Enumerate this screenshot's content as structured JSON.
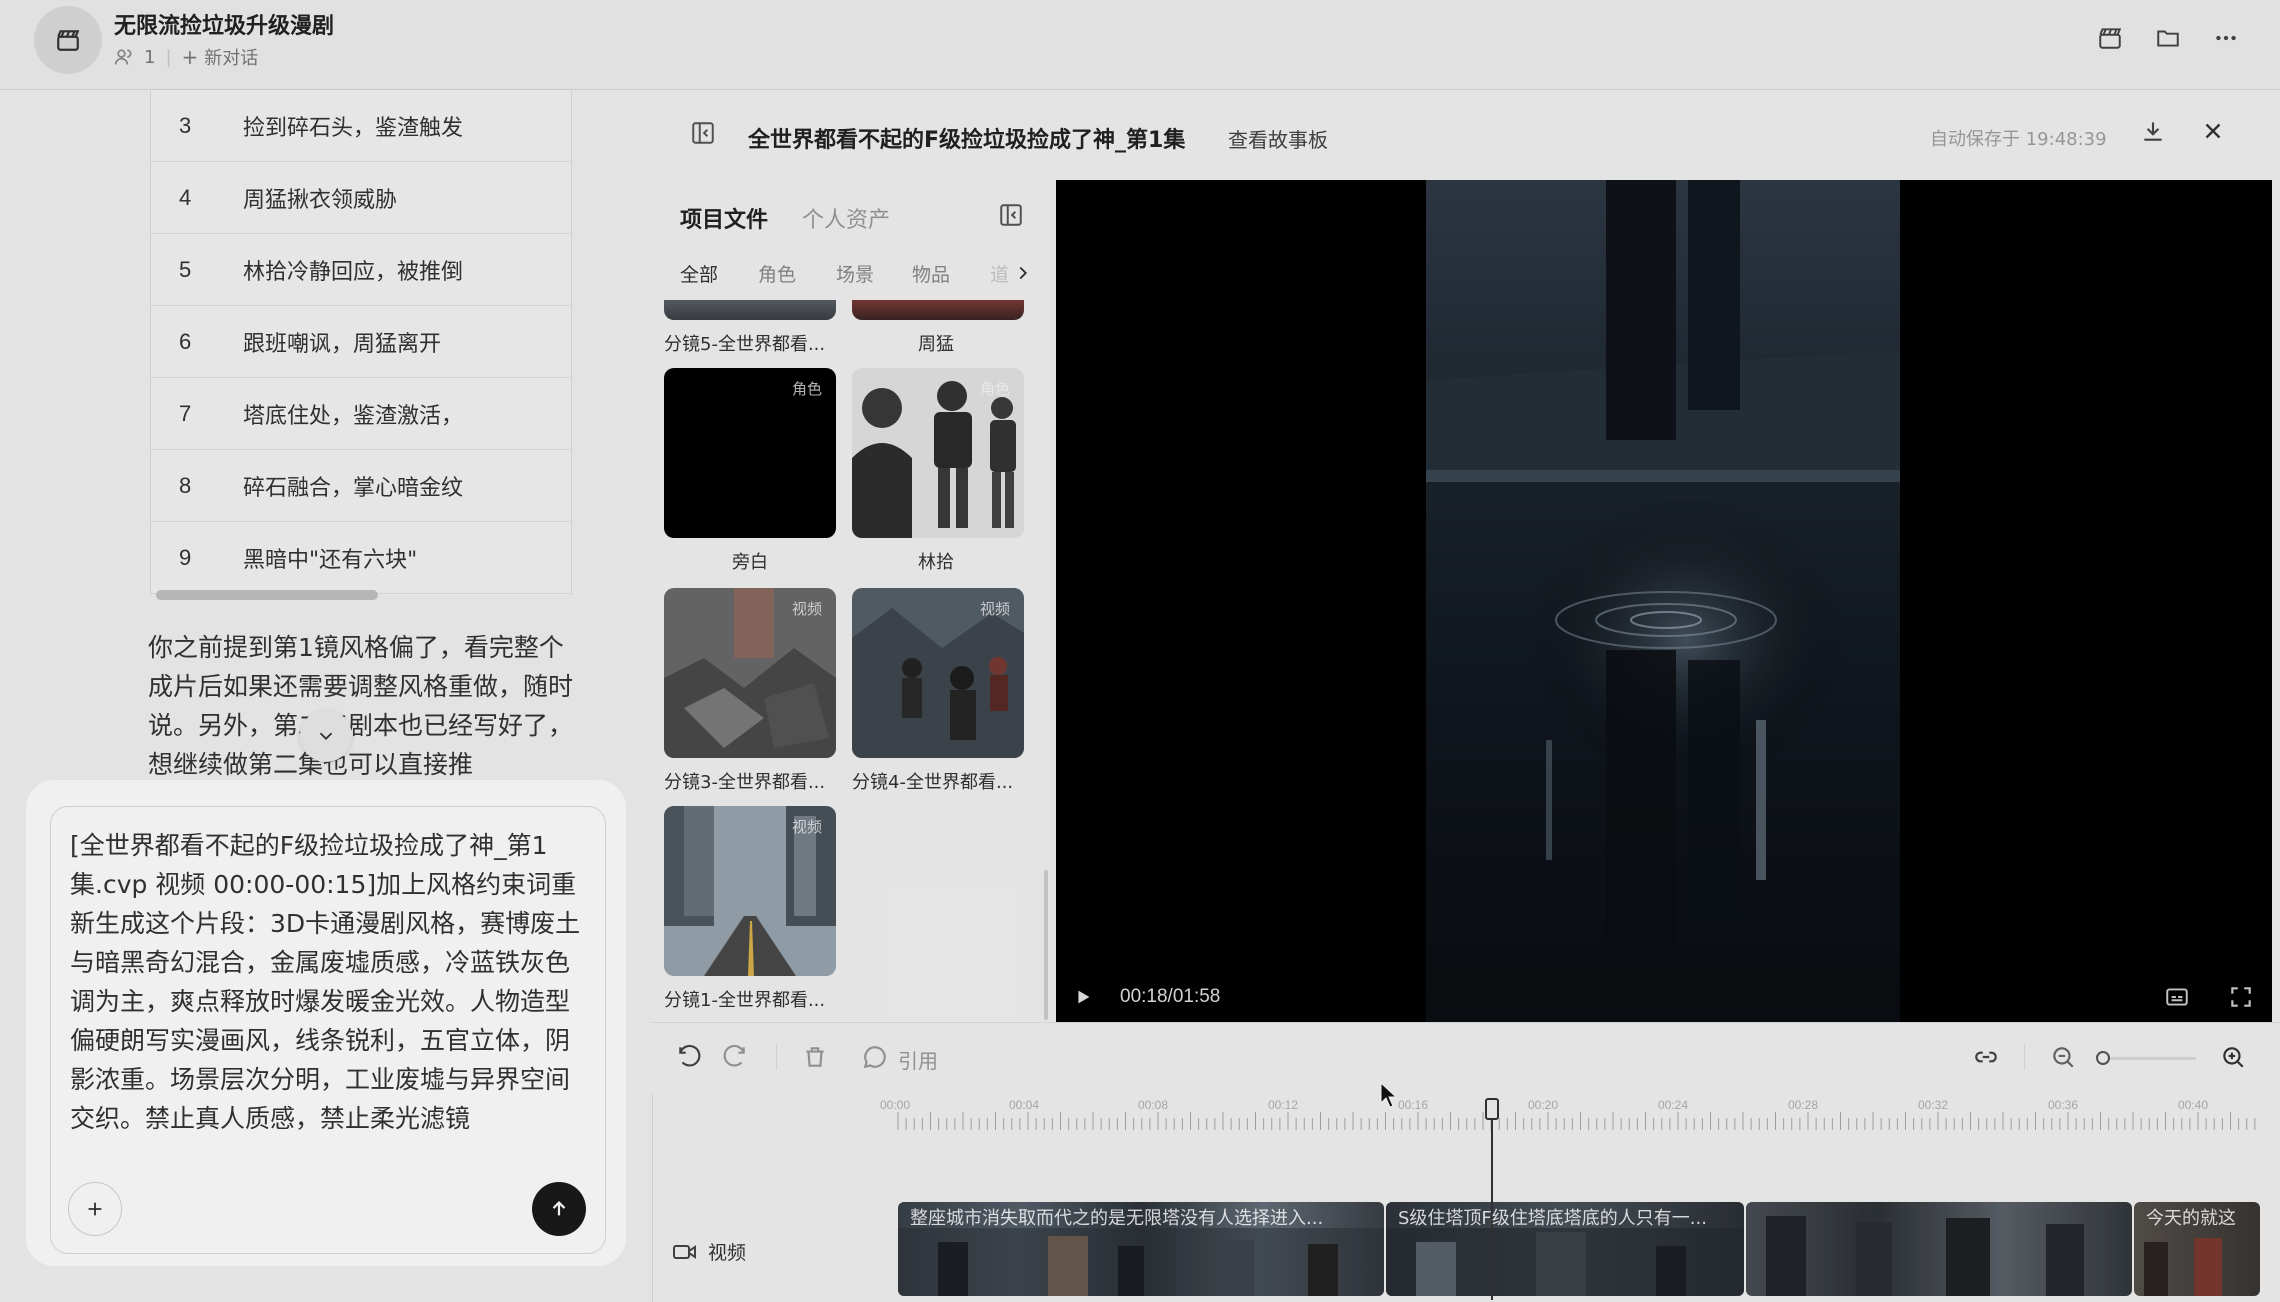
{
  "header": {
    "title": "无限流捡垃圾升级漫剧",
    "member_count": "1",
    "new_chat": "新对话"
  },
  "table": {
    "rows": [
      {
        "num": "3",
        "text": "捡到碎石头，鉴渣触发"
      },
      {
        "num": "4",
        "text": "周猛揪衣领威胁"
      },
      {
        "num": "5",
        "text": "林拾冷静回应，被推倒"
      },
      {
        "num": "6",
        "text": "跟班嘲讽，周猛离开"
      },
      {
        "num": "7",
        "text": "塔底住处，鉴渣激活，"
      },
      {
        "num": "8",
        "text": "碎石融合，掌心暗金纹"
      },
      {
        "num": "9",
        "text": "黑暗中\"还有六块\""
      }
    ]
  },
  "chat": {
    "message": "你之前提到第1镜风格偏了，看完整个成片后如果还需要调整风格重做，随时说。另外，第二集剧本也已经写好了，想继续做第二集也可以直接推"
  },
  "composer": {
    "text": "[全世界都看不起的F级捡垃圾捡成了神_第1集.cvp 视频 00:00-00:15]加上风格约束词重新生成这个片段：3D卡通漫剧风格，赛博废土与暗黑奇幻混合，金属废墟质感，冷蓝铁灰色调为主，爽点释放时爆发暖金光效。人物造型偏硬朗写实漫画风，线条锐利，五官立体，阴影浓重。场景层次分明，工业废墟与异界空间交织。禁止真人质感，禁止柔光滤镜"
  },
  "editor": {
    "title": "全世界都看不起的F级捡垃圾捡成了神_第1集",
    "storyboard_link": "查看故事板",
    "autosave": "自动保存于 19:48:39"
  },
  "assets": {
    "tabs": [
      "项目文件",
      "个人资产"
    ],
    "filters": [
      "全部",
      "角色",
      "场景",
      "物品",
      "道"
    ],
    "top_captions": [
      "分镜5-全世界都看...",
      "周猛"
    ],
    "items": [
      {
        "caption": "旁白",
        "badge": "角色"
      },
      {
        "caption": "林拾",
        "badge": "角色"
      },
      {
        "caption": "分镜3-全世界都看...",
        "badge": "视频"
      },
      {
        "caption": "分镜4-全世界都看...",
        "badge": "视频"
      },
      {
        "caption": "分镜1-全世界都看...",
        "badge": "视频"
      }
    ]
  },
  "player": {
    "timecode": "00:18/01:58"
  },
  "toolbar": {
    "quote": "引用"
  },
  "timeline": {
    "ruler_labels": [
      "00:00",
      "00:04",
      "00:08",
      "00:12",
      "00:16",
      "00:20",
      "00:24",
      "00:28",
      "00:32",
      "00:36",
      "00:40"
    ],
    "playhead_time": "00:18",
    "track_label": "视频",
    "clips": [
      {
        "title": "整座城市消失取而代之的是无限塔没有人选择进入..."
      },
      {
        "title": "S级住塔顶F级住塔底塔底的人只有一..."
      },
      {
        "title": ""
      },
      {
        "title": "今天的就这"
      }
    ]
  },
  "colors": {
    "accent_dark": "#1a1a1a",
    "panel_bg": "#f3f3f3",
    "muted_text": "#9a9a9a"
  },
  "icons": [
    "clapperboard-icon",
    "people-icon",
    "plus-icon",
    "folder-icon",
    "more-icon",
    "sidebar-collapse-icon",
    "download-icon",
    "close-icon",
    "chevron-right-icon",
    "chevron-down-icon",
    "send-arrow-icon",
    "play-icon",
    "subtitle-icon",
    "fullscreen-icon",
    "undo-icon",
    "redo-icon",
    "trash-icon",
    "comment-icon",
    "link-icon",
    "zoom-out-icon",
    "zoom-in-icon",
    "video-camera-icon"
  ]
}
